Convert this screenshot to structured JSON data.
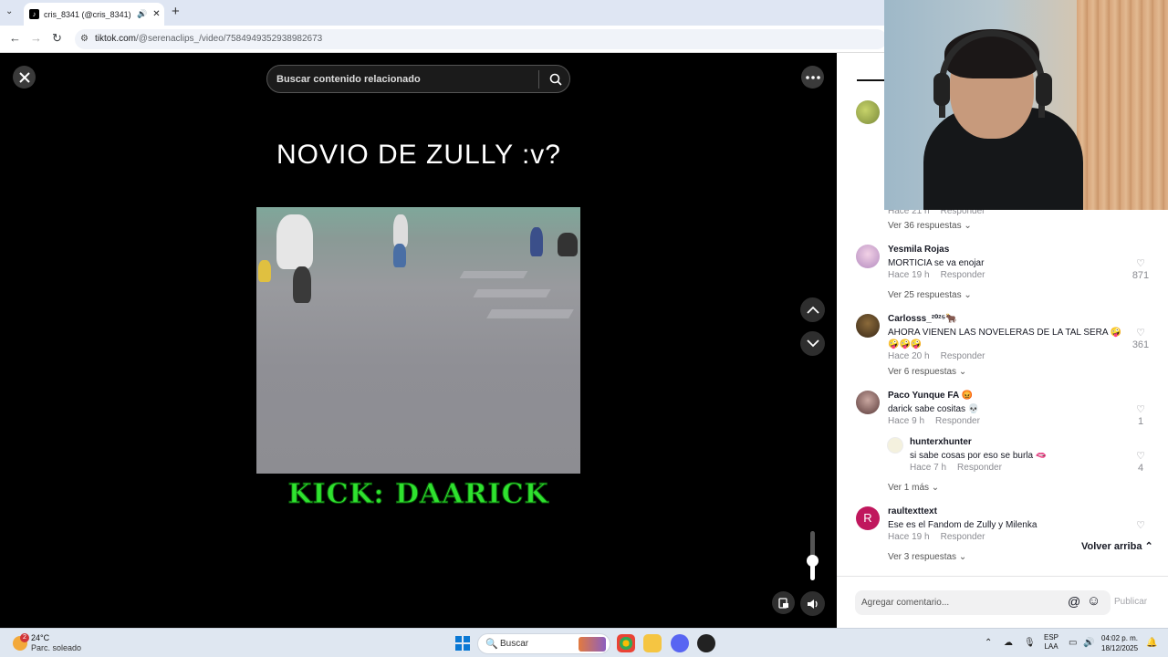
{
  "browser": {
    "tab_title": "cris_8341 (@cris_8341) | TikTok",
    "tab_close": "✕",
    "new_tab": "+",
    "url_host": "tiktok.com",
    "url_path": "/@serenaclips_/video/7584949352938982673"
  },
  "video": {
    "search_placeholder": "Buscar contenido relacionado",
    "title": "NOVIO DE ZULLY :v?",
    "caption": "KICK: DAARICK",
    "volume_level": 0.4
  },
  "comments": {
    "back_to_top": "Volver arriba",
    "items": [
      {
        "partial_meta": "Hace 21 h",
        "partial_reply": "Responder",
        "more": "Ver 36 respuestas"
      },
      {
        "user": "Yesmila Rojas",
        "text": "MORTICIA se va enojar",
        "time": "Hace 19 h",
        "reply": "Responder",
        "likes": "871",
        "more": "Ver 25 respuestas"
      },
      {
        "user": "Carlosss_²⁰²⁵🐂",
        "text": "AHORA VIENEN LAS NOVELERAS DE LA TAL SERA 🤪🤪🤪🤪",
        "time": "Hace 20 h",
        "reply": "Responder",
        "likes": "361",
        "more": "Ver 6 respuestas"
      },
      {
        "user": "Paco Yunque FA 😡",
        "text": "darick sabe cositas 💀",
        "time": "Hace 9 h",
        "reply": "Responder",
        "likes": "1"
      },
      {
        "user": "hunterxhunter",
        "text": "si sabe cosas por eso se burla 🫦",
        "time": "Hace 7 h",
        "reply": "Responder",
        "likes": "4",
        "more": "Ver 1 más"
      },
      {
        "user": "raultexttext",
        "avatar_letter": "R",
        "text": "Ese es el Fandom de Zully y Milenka",
        "time": "Hace 19 h",
        "reply": "Responder",
        "more": "Ver 3 respuestas"
      }
    ],
    "input_placeholder": "Agregar comentario...",
    "publish": "Publicar"
  },
  "taskbar": {
    "temp": "24°C",
    "condition": "Parc. soleado",
    "weather_badge": "2",
    "search_label": "Buscar",
    "lang_1": "ESP",
    "lang_2": "LAA",
    "time": "04:02 p. m.",
    "date": "18/12/2025"
  }
}
